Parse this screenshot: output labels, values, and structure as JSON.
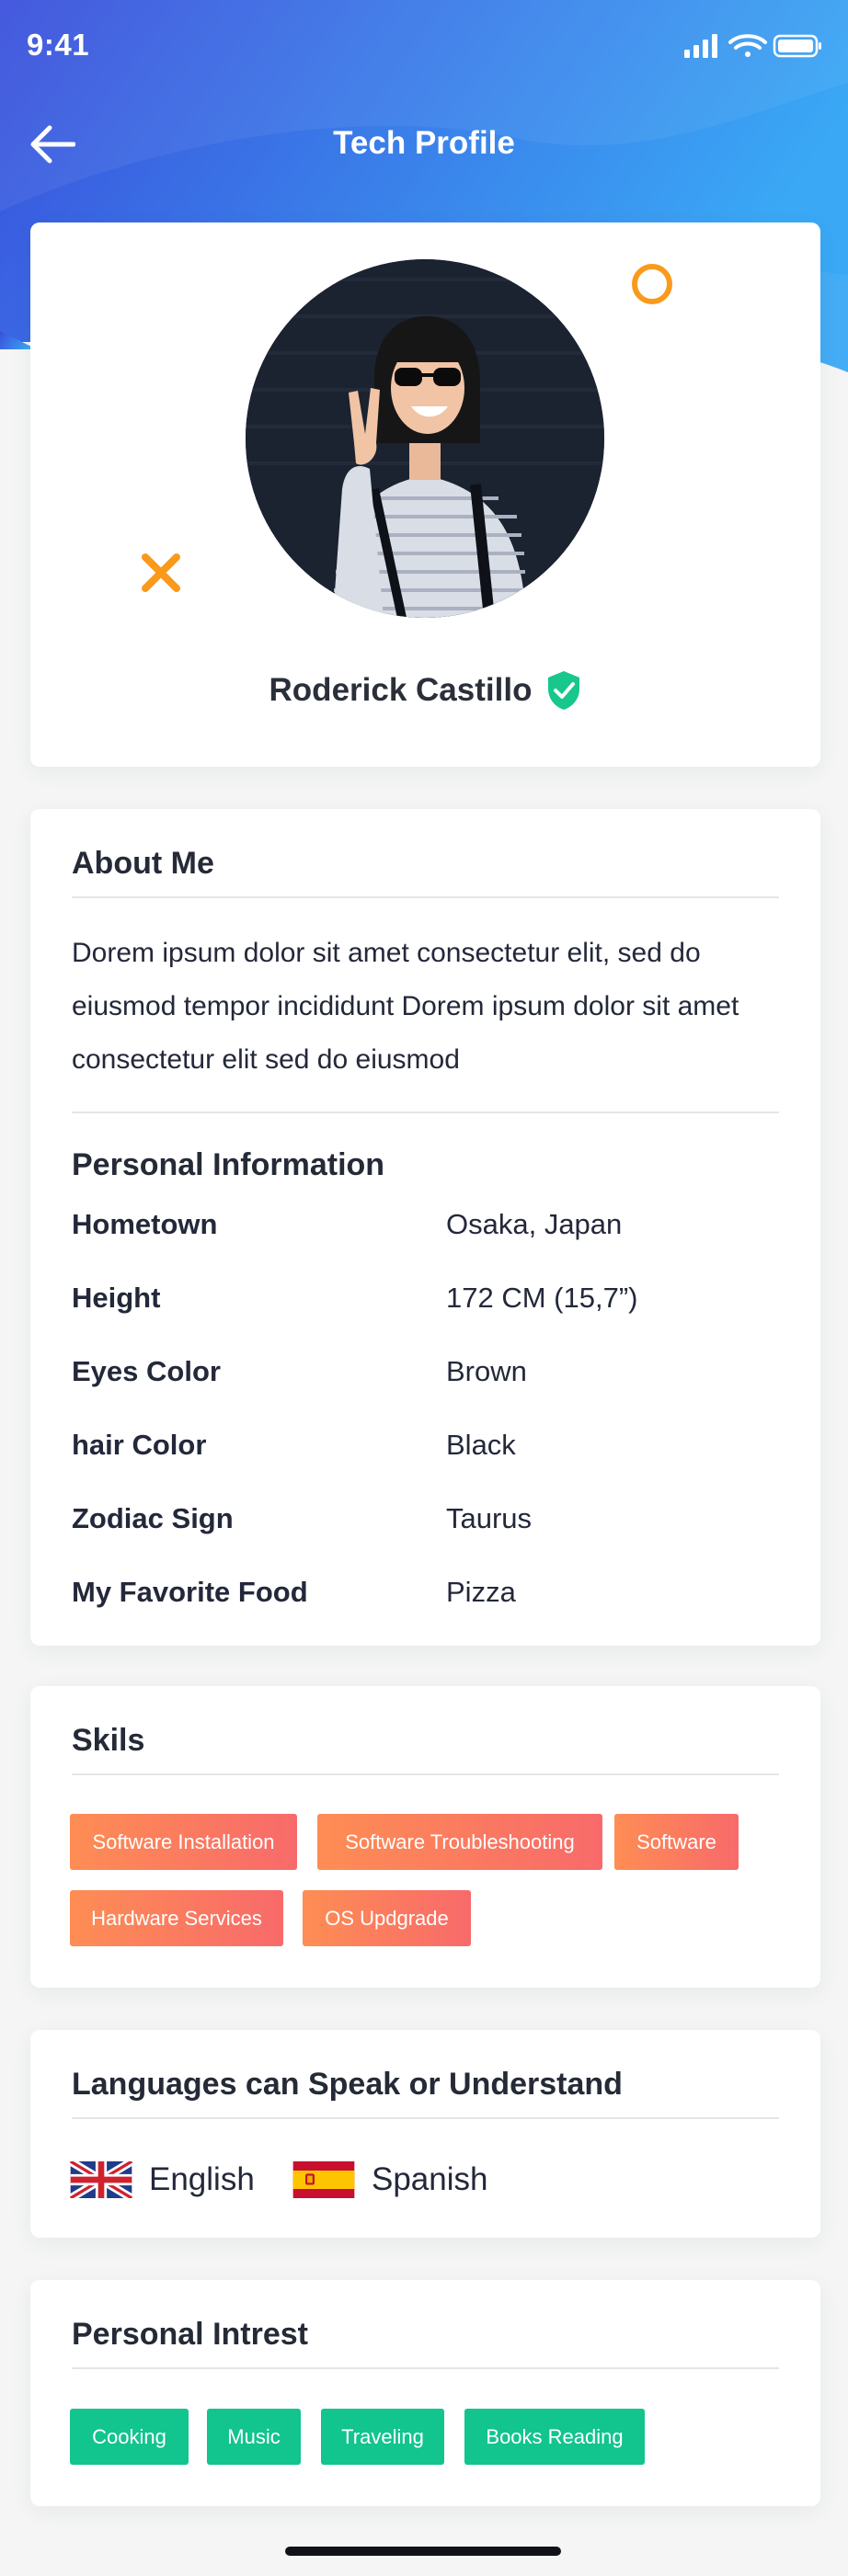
{
  "status_bar": {
    "time": "9:41"
  },
  "nav": {
    "title": "Tech Profile"
  },
  "profile": {
    "name": "Roderick Castillo"
  },
  "about": {
    "title": "About Me",
    "text": "Dorem ipsum dolor sit amet consectetur elit, sed do eiusmod tempor incididunt Dorem ipsum dolor sit amet consectetur elit sed do eiusmod"
  },
  "personal_info": {
    "title": "Personal Information",
    "rows": [
      {
        "label": "Hometown",
        "value": "Osaka, Japan"
      },
      {
        "label": "Height",
        "value": "172 CM (15,7”)"
      },
      {
        "label": "Eyes Color",
        "value": "Brown"
      },
      {
        "label": "hair Color",
        "value": "Black"
      },
      {
        "label": "Zodiac Sign",
        "value": "Taurus"
      },
      {
        "label": "My Favorite Food",
        "value": "Pizza"
      }
    ]
  },
  "skills": {
    "title": "Skils",
    "tags": [
      "Software Installation",
      "Software Troubleshooting",
      "Software",
      "Hardware Services",
      "OS Updgrade"
    ]
  },
  "languages": {
    "title": "Languages can Speak or Understand",
    "items": [
      {
        "label": "English",
        "icon": "uk-flag-icon"
      },
      {
        "label": "Spanish",
        "icon": "spain-flag-icon"
      }
    ]
  },
  "interests": {
    "title": "Personal Intrest",
    "tags": [
      "Cooking",
      "Music",
      "Traveling",
      "Books Reading"
    ]
  },
  "colors": {
    "header_gradient_start": "#3a4fdc",
    "header_gradient_end": "#3aa8f5",
    "accent_orange": "#f99a1c",
    "skill_tag_start": "#fe8d54",
    "skill_tag_end": "#f86a6a",
    "interest_tag": "#12c48e",
    "verified": "#17c78b"
  }
}
